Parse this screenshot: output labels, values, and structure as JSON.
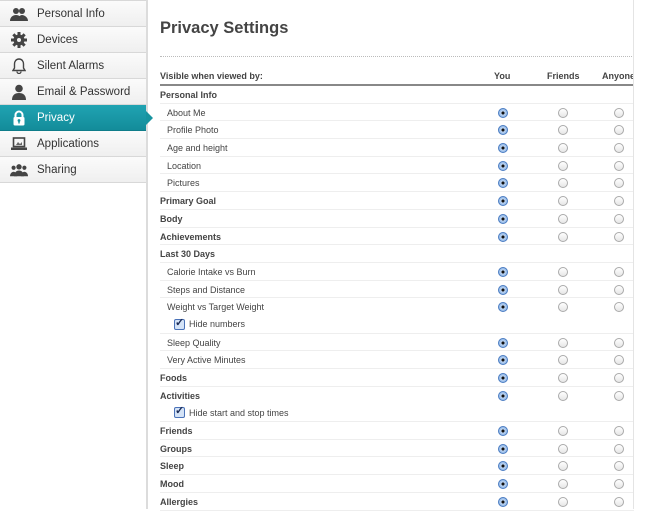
{
  "sidebar": {
    "items": [
      {
        "label": "Personal Info",
        "icon": "users-icon",
        "active": false
      },
      {
        "label": "Devices",
        "icon": "gear-icon",
        "active": false
      },
      {
        "label": "Silent Alarms",
        "icon": "bell-icon",
        "active": false
      },
      {
        "label": "Email & Password",
        "icon": "user-icon",
        "active": false
      },
      {
        "label": "Privacy",
        "icon": "lock-icon",
        "active": true
      },
      {
        "label": "Applications",
        "icon": "laptop-icon",
        "active": false
      },
      {
        "label": "Sharing",
        "icon": "group-icon",
        "active": false
      }
    ]
  },
  "main": {
    "title": "Privacy Settings",
    "header": {
      "label": "Visible when viewed by:",
      "you": "You",
      "friends": "Friends",
      "anyone": "Anyone"
    },
    "rows": [
      {
        "label": "Personal Info",
        "type": "section"
      },
      {
        "label": "About Me",
        "type": "sub",
        "value": "You"
      },
      {
        "label": "Profile Photo",
        "type": "sub",
        "value": "You"
      },
      {
        "label": "Age and height",
        "type": "sub",
        "value": "You"
      },
      {
        "label": "Location",
        "type": "sub",
        "value": "You"
      },
      {
        "label": "Pictures",
        "type": "sub",
        "value": "You"
      },
      {
        "label": "Primary Goal",
        "type": "bold",
        "value": "You"
      },
      {
        "label": "Body",
        "type": "bold",
        "value": "You"
      },
      {
        "label": "Achievements",
        "type": "bold",
        "value": "You"
      },
      {
        "label": "Last 30 Days",
        "type": "section"
      },
      {
        "label": "Calorie Intake vs Burn",
        "type": "sub",
        "value": "You"
      },
      {
        "label": "Steps and Distance",
        "type": "sub",
        "value": "You"
      },
      {
        "label": "Weight vs Target Weight",
        "type": "sub",
        "value": "You",
        "nob": true
      },
      {
        "label": "Hide numbers",
        "type": "check",
        "checked": true
      },
      {
        "label": "Sleep Quality",
        "type": "sub",
        "value": "You"
      },
      {
        "label": "Very Active Minutes",
        "type": "sub",
        "value": "You"
      },
      {
        "label": "Foods",
        "type": "bold",
        "value": "You"
      },
      {
        "label": "Activities",
        "type": "bold",
        "value": "You",
        "nob": true
      },
      {
        "label": "Hide start and stop times",
        "type": "check",
        "checked": true
      },
      {
        "label": "Friends",
        "type": "bold",
        "value": "You"
      },
      {
        "label": "Groups",
        "type": "bold",
        "value": "You"
      },
      {
        "label": "Sleep",
        "type": "bold",
        "value": "You"
      },
      {
        "label": "Mood",
        "type": "bold",
        "value": "You"
      },
      {
        "label": "Allergies",
        "type": "bold",
        "value": "You"
      }
    ]
  },
  "colors": {
    "accent": "#1a9aa8",
    "radio_selected": "#7aa8e0"
  }
}
